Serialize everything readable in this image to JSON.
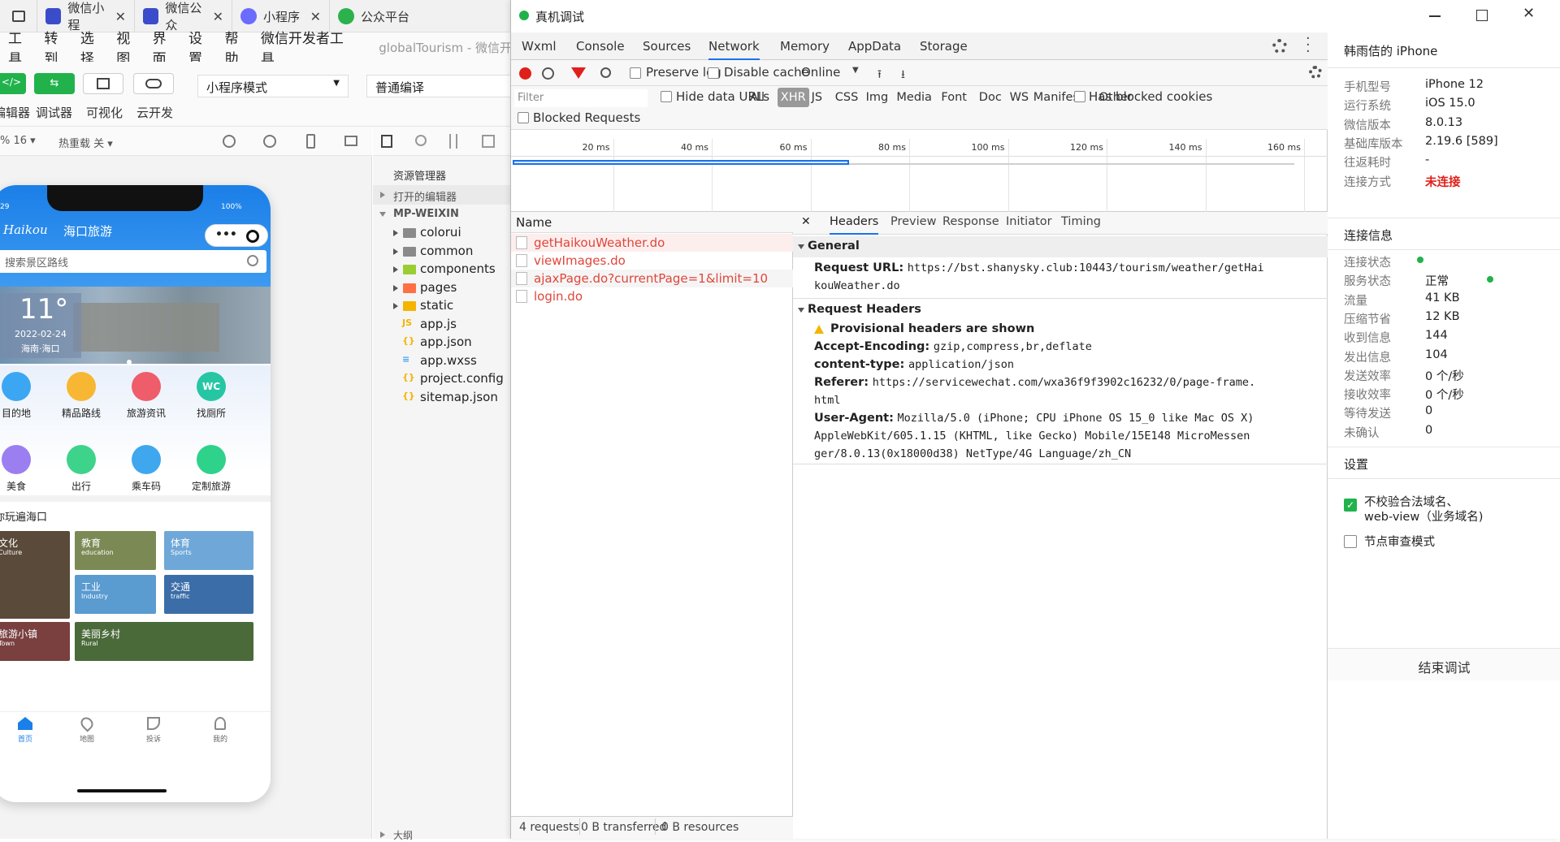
{
  "browser_tabs": [
    {
      "label": "微信小程",
      "color": "#3b4cca"
    },
    {
      "label": "微信公众",
      "color": "#3b4cca"
    },
    {
      "label": "小程序",
      "color": "#6b6bff"
    },
    {
      "label": "公众平台",
      "color": "#2bb24c"
    }
  ],
  "menu": [
    "工具",
    "转到",
    "选择",
    "视图",
    "界面",
    "设置",
    "帮助",
    "微信开发者工具"
  ],
  "project_title": "globalTourism - 微信开",
  "toolbar": {
    "buttons": [
      "编辑器",
      "调试器",
      "可视化",
      "云开发"
    ],
    "mode_select": "小程序模式",
    "compile_select": "普通编译",
    "zoom": "% 16 ▾",
    "hot_reload": "热重载 关 ▾"
  },
  "phone": {
    "time": "29",
    "battery": "100%",
    "title": "海口旅游",
    "search_placeholder": "搜索景区路线",
    "banner_temp": "11°",
    "banner_date": "2022-02-24",
    "banner_place": "海南·海口",
    "icons_row1": [
      {
        "label": "目的地",
        "color": "#3ba7f3"
      },
      {
        "label": "精品路线",
        "color": "#f7b733"
      },
      {
        "label": "旅游资讯",
        "color": "#ef5d6a"
      },
      {
        "label": "找厕所",
        "color": "#26c6a4",
        "text": "WC"
      }
    ],
    "icons_row2": [
      {
        "label": "美食",
        "color": "#9b7ef0"
      },
      {
        "label": "出行",
        "color": "#3ed38a"
      },
      {
        "label": "乘车码",
        "color": "#3fa7ee"
      },
      {
        "label": "定制旅游",
        "color": "#2fd28a"
      }
    ],
    "section_title": "带你玩遍海口",
    "tiles": [
      {
        "cn": "文化",
        "en": "Culture",
        "color": "#5a4a3a"
      },
      {
        "cn": "教育",
        "en": "education",
        "color": "#7b8a55"
      },
      {
        "cn": "体育",
        "en": "Sports",
        "color": "#6fa8d8"
      },
      {
        "cn": "工业",
        "en": "Industry",
        "color": "#5a9bd0"
      },
      {
        "cn": "交通",
        "en": "traffic",
        "color": "#3b6ea8"
      },
      {
        "cn": "旅游小镇",
        "en": "Town",
        "color": "#7a3f3f"
      },
      {
        "cn": "美丽乡村",
        "en": "Rural",
        "color": "#4a6a3a"
      }
    ],
    "nav": [
      "首页",
      "地图",
      "投诉",
      "我的"
    ]
  },
  "explorer": {
    "title": "资源管理器",
    "open_editors": "打开的编辑器",
    "root": "MP-WEIXIN",
    "items": [
      {
        "name": "colorui",
        "type": "folder"
      },
      {
        "name": "common",
        "type": "folder"
      },
      {
        "name": "components",
        "type": "folder-comp"
      },
      {
        "name": "pages",
        "type": "folder-pages"
      },
      {
        "name": "static",
        "type": "folder-static"
      },
      {
        "name": "app.js",
        "type": "js"
      },
      {
        "name": "app.json",
        "type": "json"
      },
      {
        "name": "app.wxss",
        "type": "css"
      },
      {
        "name": "project.config",
        "type": "json"
      },
      {
        "name": "sitemap.json",
        "type": "json"
      }
    ],
    "outline": "大纲"
  },
  "devtools": {
    "window_title": "真机调试",
    "tabs": [
      "Wxml",
      "Console",
      "Sources",
      "Network",
      "Memory",
      "AppData",
      "Storage"
    ],
    "active_tab": "Network",
    "preserve_log": "Preserve log",
    "disable_cache": "Disable cache",
    "throttle": "Online",
    "filter_placeholder": "Filter",
    "hide_data_urls": "Hide data URLs",
    "types": [
      "All",
      "XHR",
      "JS",
      "CSS",
      "Img",
      "Media",
      "Font",
      "Doc",
      "WS",
      "Manifest",
      "Other"
    ],
    "active_type": "XHR",
    "blocked_cookies": "Has blocked cookies",
    "blocked_requests": "Blocked Requests",
    "timeline": [
      "20 ms",
      "40 ms",
      "60 ms",
      "80 ms",
      "100 ms",
      "120 ms",
      "140 ms",
      "160 ms"
    ],
    "name_header": "Name",
    "requests": [
      "getHaikouWeather.do",
      "viewImages.do",
      "ajaxPage.do?currentPage=1&limit=10",
      "login.do"
    ],
    "detail_tabs": [
      "Headers",
      "Preview",
      "Response",
      "Initiator",
      "Timing"
    ],
    "general_title": "General",
    "request_url_label": "Request URL:",
    "request_url_1": "https://bst.shanysky.club:10443/tourism/weather/getHai",
    "request_url_2": "kouWeather.do",
    "req_headers_title": "Request Headers",
    "provisional": "Provisional headers are shown",
    "accept_enc_label": "Accept-Encoding:",
    "accept_enc": "gzip,compress,br,deflate",
    "ctype_label": "content-type:",
    "ctype": "application/json",
    "referer_label": "Referer:",
    "referer_1": "https://servicewechat.com/wxa36f9f3902c16232/0/page-frame.",
    "referer_2": "html",
    "ua_label": "User-Agent:",
    "ua_1": "Mozilla/5.0 (iPhone; CPU iPhone OS 15_0 like Mac OS X)",
    "ua_2": "AppleWebKit/605.1.15 (KHTML, like Gecko) Mobile/15E148 MicroMessen",
    "ua_3": "ger/8.0.13(0x18000d38) NetType/4G Language/zh_CN",
    "status": [
      "4 requests",
      "0 B transferred",
      "0 B resources"
    ]
  },
  "device_panel": {
    "device_title": "韩雨佶的 iPhone",
    "rows": [
      {
        "k": "手机型号",
        "v": "iPhone 12"
      },
      {
        "k": "运行系统",
        "v": "iOS 15.0"
      },
      {
        "k": "微信版本",
        "v": "8.0.13"
      },
      {
        "k": "基础库版本",
        "v": "2.19.6 [589]"
      },
      {
        "k": "往返耗时",
        "v": "-"
      },
      {
        "k": "连接方式",
        "v": "未连接"
      }
    ],
    "conn_title": "连接信息",
    "conn_rows": [
      {
        "k": "连接状态",
        "v": ""
      },
      {
        "k": "服务状态",
        "v": "正常"
      },
      {
        "k": "流量",
        "v": "41 KB"
      },
      {
        "k": "压缩节省",
        "v": "12 KB"
      },
      {
        "k": "收到信息",
        "v": "144"
      },
      {
        "k": "发出信息",
        "v": "104"
      },
      {
        "k": "发送效率",
        "v": "0 个/秒"
      },
      {
        "k": "接收效率",
        "v": "0 个/秒"
      },
      {
        "k": "等待发送",
        "v": "0"
      },
      {
        "k": "未确认",
        "v": "0"
      }
    ],
    "settings_title": "设置",
    "opt1": "不校验合法域名、web-view（业务域名)",
    "opt2": "节点审查模式",
    "end_button": "结束调试"
  },
  "colors": {
    "error_red": "#e0463a",
    "green": "#21b24c",
    "accent_blue": "#1a73e8"
  }
}
